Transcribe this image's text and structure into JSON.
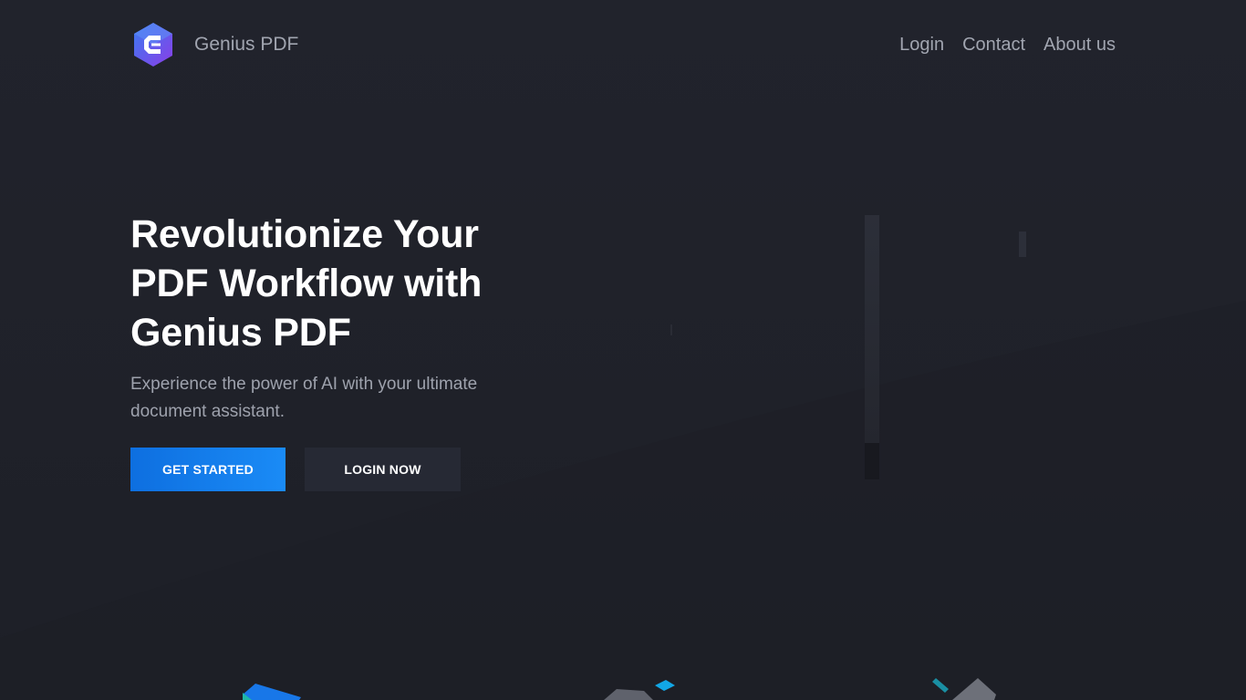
{
  "header": {
    "brand": "Genius PDF",
    "nav": [
      "Login",
      "Contact",
      "About us"
    ]
  },
  "hero": {
    "title": "Revolutionize Your PDF Workflow with Genius PDF",
    "subtitle": "Experience the power of AI with your ultimate document assistant.",
    "primary_button": "GET STARTED",
    "secondary_button": "LOGIN NOW"
  },
  "colors": {
    "background": "#1f212a",
    "primary_button": "#1380ec",
    "secondary_button": "#262934",
    "text_muted": "#a1a5b0",
    "logo_gradient": [
      "#3a7bf0",
      "#8a3ee8"
    ]
  },
  "icons": [
    "logo-icon"
  ]
}
